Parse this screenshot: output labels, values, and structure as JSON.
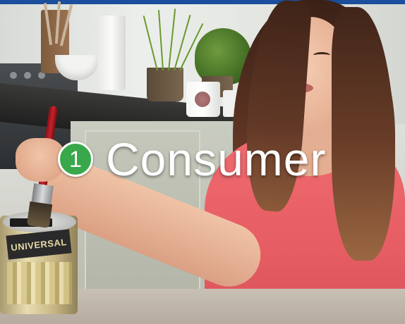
{
  "overlay": {
    "badge_number": "1",
    "headline": "Consumer"
  },
  "product": {
    "label": "UNIVERSAL"
  },
  "colors": {
    "top_bar": "#1b4e9c",
    "badge": "#39a84a",
    "headline": "#ffffff"
  },
  "icons": [
    "step-number-badge"
  ]
}
